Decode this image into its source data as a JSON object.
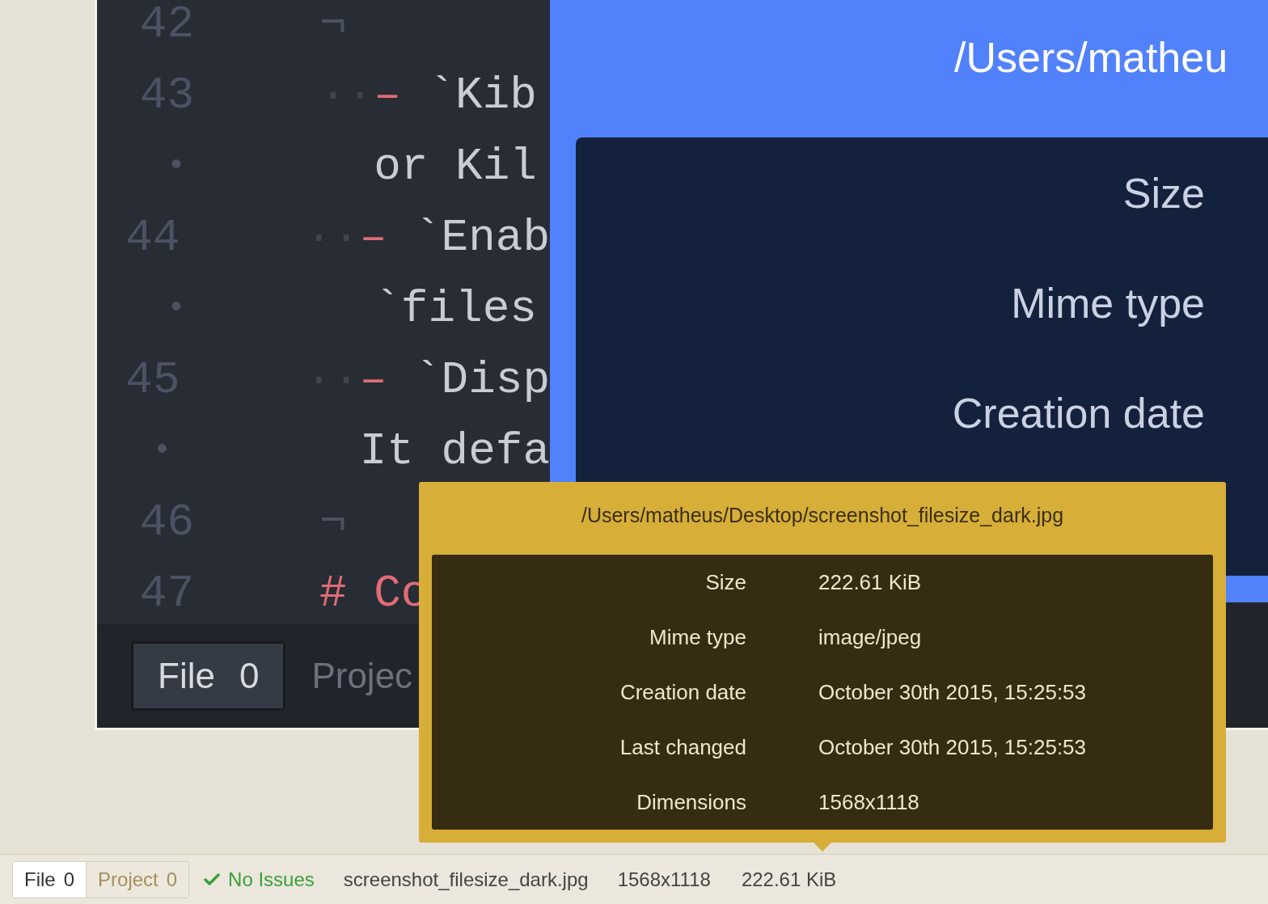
{
  "image": {
    "editor": {
      "lines": [
        {
          "gutter": "42",
          "kind": "eol",
          "text": "¬"
        },
        {
          "gutter": "43",
          "kind": "item",
          "indent": "··",
          "marker": "–",
          "text": "`Kib"
        },
        {
          "gutter": "•",
          "kind": "wrap",
          "text": "or Kil"
        },
        {
          "gutter": "44",
          "kind": "item",
          "indent": "··",
          "marker": "–",
          "text": "`Enab"
        },
        {
          "gutter": "•",
          "kind": "wrap",
          "text": "`files"
        },
        {
          "gutter": "45",
          "kind": "item",
          "indent": "··",
          "marker": "–",
          "text": "`Disp"
        },
        {
          "gutter": "•",
          "kind": "wrap",
          "text": "It defa"
        },
        {
          "gutter": "46",
          "kind": "eol",
          "text": "¬"
        },
        {
          "gutter": "47",
          "kind": "heading",
          "text": "# Co"
        }
      ]
    },
    "editor_tabs": [
      {
        "label": "File",
        "count": "0",
        "selected": true
      },
      {
        "label": "Projec",
        "selected": false
      }
    ],
    "details_panel": {
      "title": "/Users/matheu",
      "labels": [
        "Size",
        "Mime type",
        "Creation date"
      ]
    }
  },
  "tooltip": {
    "title": "/Users/matheus/Desktop/screenshot_filesize_dark.jpg",
    "rows": [
      {
        "label": "Size",
        "value": "222.61 KiB"
      },
      {
        "label": "Mime type",
        "value": "image/jpeg"
      },
      {
        "label": "Creation date",
        "value": "October 30th 2015, 15:25:53"
      },
      {
        "label": "Last changed",
        "value": "October 30th 2015, 15:25:53"
      },
      {
        "label": "Dimensions",
        "value": "1568x1118"
      }
    ]
  },
  "status_bar": {
    "tabs": [
      {
        "label": "File",
        "count": "0",
        "selected": true
      },
      {
        "label": "Project",
        "count": "0",
        "selected": false
      }
    ],
    "issues": "No Issues",
    "file_name": "screenshot_filesize_dark.jpg",
    "dimensions": "1568x1118",
    "size": "222.61 KiB"
  }
}
